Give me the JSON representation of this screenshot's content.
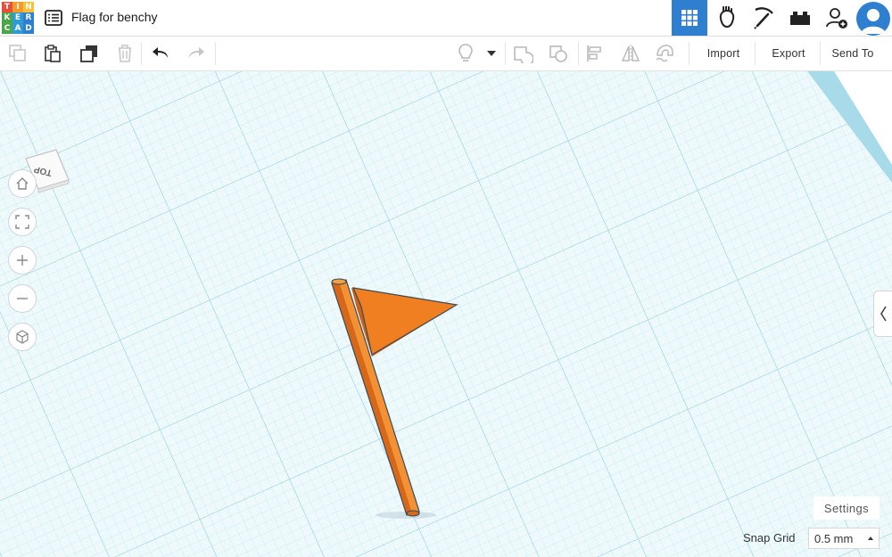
{
  "app": {
    "logo_letters": [
      "T",
      "I",
      "N",
      "K",
      "E",
      "R",
      "C",
      "A",
      "D"
    ],
    "logo_colors": [
      "#e84f39",
      "#f49b2b",
      "#f7c23a",
      "#4aa54b",
      "#2f9ad6",
      "#2f7fd1",
      "#4aa54b",
      "#2f9ad6",
      "#2f7fd1"
    ]
  },
  "header": {
    "title": "Flag for benchy",
    "buttons": [
      "3d-design",
      "circuits",
      "codeblocks",
      "bricks",
      "invite-user"
    ],
    "active_color": "#2f7fd1"
  },
  "toolbar": {
    "import_label": "Import",
    "export_label": "Export",
    "send_to_label": "Send To"
  },
  "viewcube": {
    "face_label": "TOP"
  },
  "workplane": {
    "grid_color": "#a9dbe8",
    "background": "#eef9fc",
    "object_color": "#f07f22"
  },
  "footer": {
    "settings_label": "Settings",
    "snap_grid_label": "Snap Grid",
    "snap_grid_value": "0.5 mm"
  }
}
